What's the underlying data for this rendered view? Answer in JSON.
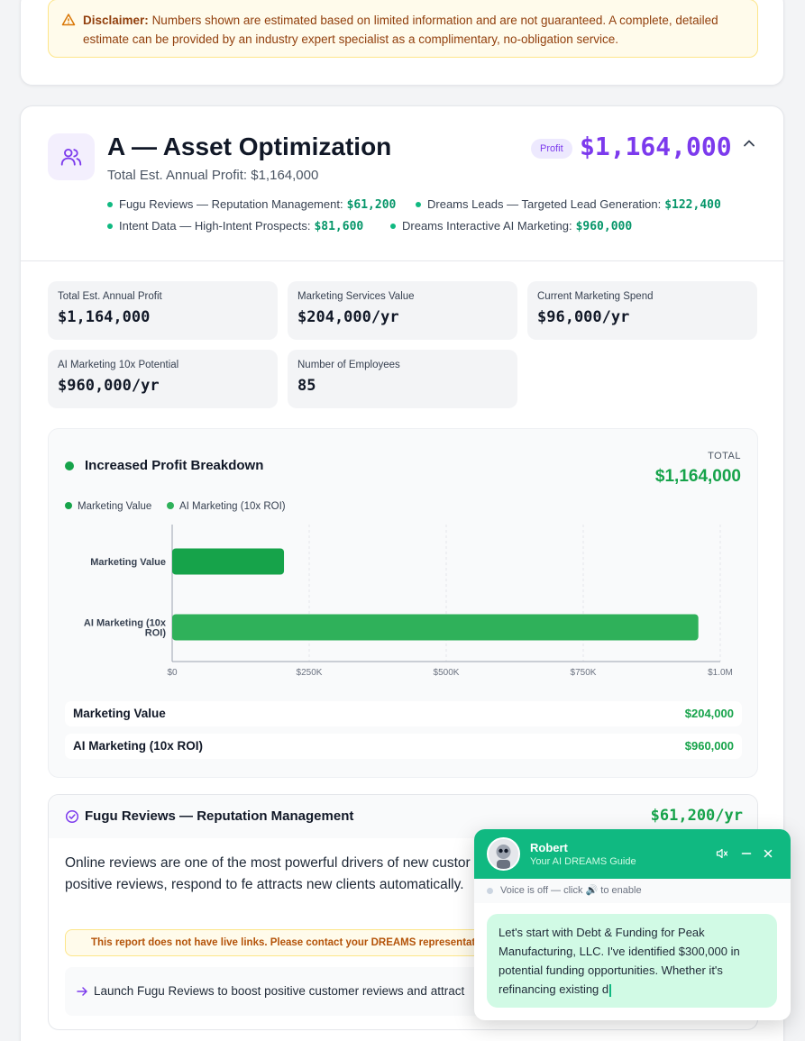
{
  "disclaimer": {
    "label": "Disclaimer:",
    "text": "Numbers shown are estimated based on limited information and are not guaranteed. A complete, detailed estimate can be provided by an industry expert specialist as a complimentary, no-obligation service."
  },
  "section": {
    "title": "A — Asset Optimization",
    "subtitle": "Total Est. Annual Profit: $1,164,000",
    "badge": "Profit",
    "amount": "$1,164,000",
    "services": [
      {
        "label": "Fugu Reviews — Reputation Management:",
        "value": "$61,200"
      },
      {
        "label": "Dreams Leads — Targeted Lead Generation:",
        "value": "$122,400"
      },
      {
        "label": "Intent Data — High-Intent Prospects:",
        "value": "$81,600"
      },
      {
        "label": "Dreams Interactive AI Marketing:",
        "value": "$960,000"
      }
    ]
  },
  "stats": [
    {
      "label": "Total Est. Annual Profit",
      "value": "$1,164,000"
    },
    {
      "label": "Marketing Services Value",
      "value": "$204,000/yr"
    },
    {
      "label": "Current Marketing Spend",
      "value": "$96,000/yr"
    },
    {
      "label": "AI Marketing 10x Potential",
      "value": "$960,000/yr"
    },
    {
      "label": "Number of Employees",
      "value": "85"
    }
  ],
  "breakdown": {
    "title": "Increased Profit Breakdown",
    "total_label": "TOTAL",
    "total_value": "$1,164,000",
    "rows": [
      {
        "label": "Marketing Value",
        "value": "$204,000"
      },
      {
        "label": "AI Marketing (10x ROI)",
        "value": "$960,000"
      }
    ]
  },
  "chart_data": {
    "type": "bar",
    "orientation": "horizontal",
    "categories": [
      "Marketing Value",
      "AI Marketing (10x ROI)"
    ],
    "values": [
      204000,
      960000
    ],
    "series": [
      {
        "name": "Marketing Value",
        "values": [
          204000,
          null
        ]
      },
      {
        "name": "AI Marketing (10x ROI)",
        "values": [
          null,
          960000
        ]
      }
    ],
    "legend": [
      "Marketing Value",
      "AI Marketing (10x ROI)"
    ],
    "xticks": [
      "$0",
      "$250K",
      "$500K",
      "$750K",
      "$1.0M"
    ],
    "xlim": [
      0,
      1000000
    ],
    "grid": true,
    "colors": [
      "#16a34a",
      "#2fb15a"
    ]
  },
  "fugu": {
    "title": "Fugu Reviews — Reputation Management",
    "amount": "$61,200/yr",
    "body": "Online reviews are one of the most powerful drivers of new custor Manufacturing, LLC generate more positive reviews, respond to fe attracts new clients automatically.",
    "warning": "This report does not have live links. Please contact your DREAMS representative",
    "action": "Launch Fugu Reviews to boost positive customer reviews and attract"
  },
  "chat": {
    "name": "Robert",
    "role": "Your AI DREAMS Guide",
    "voice": "Voice is off — click 🔊 to enable",
    "message": "Let's start with Debt & Funding for Peak Manufacturing, LLC. I've identified $300,000 in potential funding opportunities. Whether it's refinancing existing d"
  }
}
